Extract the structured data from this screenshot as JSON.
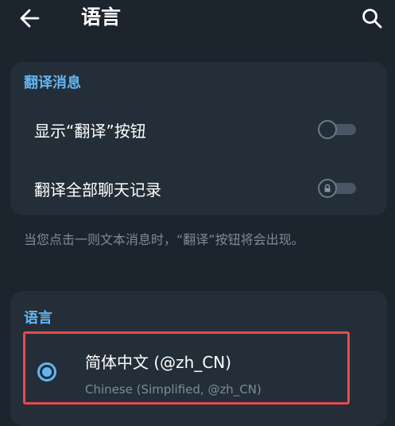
{
  "header": {
    "title": "语言",
    "back_icon": "arrow-left-icon",
    "search_icon": "search-icon"
  },
  "translate_section": {
    "header": "翻译消息",
    "rows": [
      {
        "label": "显示“翻译”按钮",
        "toggle_on": false,
        "locked": false
      },
      {
        "label": "翻译全部聊天记录",
        "toggle_on": false,
        "locked": true
      }
    ],
    "info": "当您点击一则文本消息时，“翻译”按钮将会出现。"
  },
  "language_section": {
    "header": "语言",
    "selected": {
      "name": "简体中文 (@zh_CN)",
      "subtitle": "Chinese (Simplified, @zh_CN)",
      "checked": true
    }
  },
  "colors": {
    "background": "#1c242e",
    "card": "#242e38",
    "accent": "#63b5f0",
    "highlight_border": "#e64b4b",
    "secondary_text": "#7d8b99"
  }
}
